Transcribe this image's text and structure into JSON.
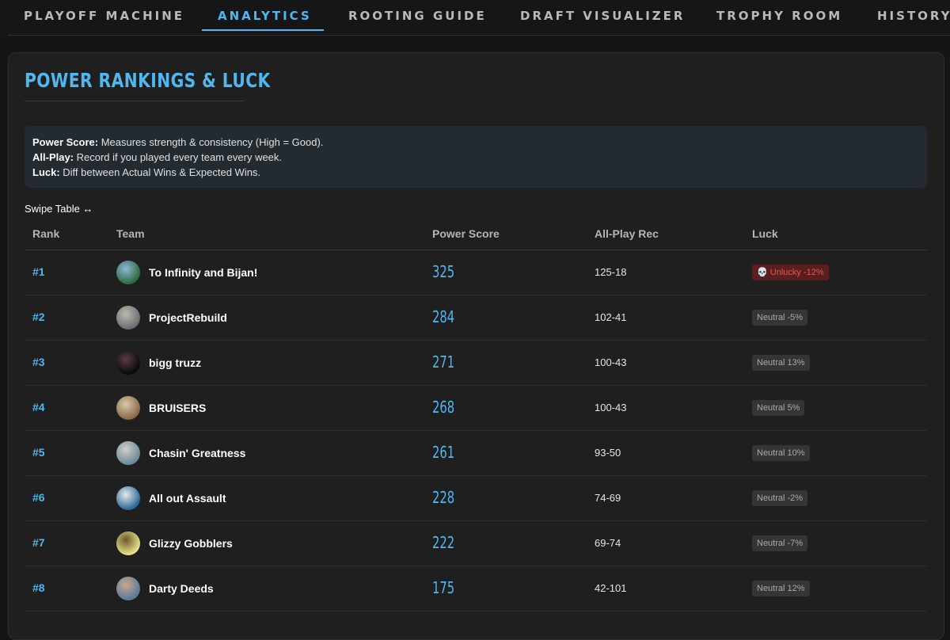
{
  "nav": {
    "tabs": [
      {
        "label": "PLAYOFF MACHINE"
      },
      {
        "label": "ANALYTICS",
        "active": true
      },
      {
        "label": "ROOTING GUIDE"
      },
      {
        "label": "DRAFT VISUALIZER"
      },
      {
        "label": "TROPHY ROOM"
      },
      {
        "label": "HISTORY"
      }
    ]
  },
  "section": {
    "title": "POWER RANKINGS & LUCK",
    "info": [
      {
        "term": "Power Score:",
        "text": " Measures strength & consistency (High = Good)."
      },
      {
        "term": "All-Play:",
        "text": " Record if you played every team every week."
      },
      {
        "term": "Luck:",
        "text": " Diff between Actual Wins & Expected Wins."
      }
    ],
    "swipe_hint": "Swipe Table ↔"
  },
  "table": {
    "headers": {
      "rank": "Rank",
      "team": "Team",
      "power": "Power Score",
      "allplay": "All-Play Rec",
      "luck": "Luck"
    },
    "rows": [
      {
        "rank": "#1",
        "team": "To Infinity and Bijan!",
        "power": "325",
        "allplay": "125-18",
        "luck": "💀 Unlucky -12%",
        "luck_type": "unlucky",
        "avatar_colors": [
          "#2e6a3e",
          "#8fb7d8"
        ]
      },
      {
        "rank": "#2",
        "team": "ProjectRebuild",
        "power": "284",
        "allplay": "102-41",
        "luck": "Neutral -5%",
        "luck_type": "neutral",
        "avatar_colors": [
          "#6a6e74",
          "#c0b8ae"
        ]
      },
      {
        "rank": "#3",
        "team": "bigg truzz",
        "power": "271",
        "allplay": "100-43",
        "luck": "Neutral 13%",
        "luck_type": "neutral",
        "avatar_colors": [
          "#0a0a0a",
          "#5a3a48"
        ]
      },
      {
        "rank": "#4",
        "team": "BRUISERS",
        "power": "268",
        "allplay": "100-43",
        "luck": "Neutral 5%",
        "luck_type": "neutral",
        "avatar_colors": [
          "#8a6a4a",
          "#d8c8a8"
        ]
      },
      {
        "rank": "#5",
        "team": "Chasin' Greatness",
        "power": "261",
        "allplay": "93-50",
        "luck": "Neutral 10%",
        "luck_type": "neutral",
        "avatar_colors": [
          "#6a8a9a",
          "#d0d0c8"
        ]
      },
      {
        "rank": "#6",
        "team": "All out Assault",
        "power": "228",
        "allplay": "74-69",
        "luck": "Neutral -2%",
        "luck_type": "neutral",
        "avatar_colors": [
          "#2a6a9a",
          "#e8e8e8"
        ]
      },
      {
        "rank": "#7",
        "team": "Glizzy Gobblers",
        "power": "222",
        "allplay": "69-74",
        "luck": "Neutral -7%",
        "luck_type": "neutral",
        "avatar_colors": [
          "#e8e088",
          "#6a5a2a"
        ]
      },
      {
        "rank": "#8",
        "team": "Darty Deeds",
        "power": "175",
        "allplay": "42-101",
        "luck": "Neutral 12%",
        "luck_type": "neutral",
        "avatar_colors": [
          "#5a7a9a",
          "#c8a88a"
        ]
      }
    ]
  },
  "colors": {
    "accent": "#4fb8f0",
    "unlucky_bg": "#5a1e1e",
    "unlucky_text": "#e05a5a",
    "neutral_bg": "#353535"
  }
}
